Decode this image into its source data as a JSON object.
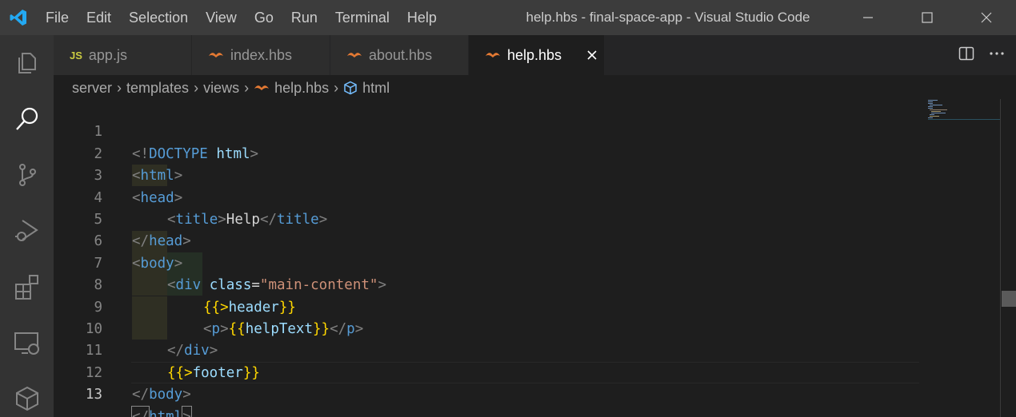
{
  "window": {
    "title": "help.hbs - final-space-app - Visual Studio Code",
    "menu": [
      "File",
      "Edit",
      "Selection",
      "View",
      "Go",
      "Run",
      "Terminal",
      "Help"
    ]
  },
  "activity_bar": [
    "explorer-icon",
    "search-icon",
    "source-control-icon",
    "run-debug-icon",
    "extensions-icon",
    "remote-explorer-icon",
    "docker-icon"
  ],
  "tabs": [
    {
      "label": "app.js",
      "icon": "JS",
      "active": false
    },
    {
      "label": "index.hbs",
      "icon": "handlebars-icon",
      "active": false
    },
    {
      "label": "about.hbs",
      "icon": "handlebars-icon",
      "active": false
    },
    {
      "label": "help.hbs",
      "icon": "handlebars-icon",
      "active": true
    }
  ],
  "breadcrumb": [
    "server",
    "templates",
    "views",
    "help.hbs",
    "html"
  ],
  "editor": {
    "line_numbers": [
      "1",
      "2",
      "3",
      "4",
      "5",
      "6",
      "7",
      "8",
      "9",
      "10",
      "11",
      "12",
      "13"
    ],
    "current_line": 13,
    "lines": {
      "l1": {
        "open": "<!",
        "tag": "DOCTYPE",
        "text": " html",
        "close": ">"
      },
      "l2": {
        "open": "<",
        "tag": "html",
        "close": ">"
      },
      "l3": {
        "open": "<",
        "tag": "head",
        "close": ">"
      },
      "l4": {
        "open": "<",
        "tag": "title",
        "mid": ">",
        "text": "Help",
        "open2": "</",
        "tag2": "title",
        "close": ">"
      },
      "l5": {
        "open": "</",
        "tag": "head",
        "close": ">"
      },
      "l6": {
        "open": "<",
        "tag": "body",
        "close": ">"
      },
      "l7": {
        "open": "<",
        "tag": "div",
        "attr": " class",
        "eq": "=",
        "str": "\"main-content\"",
        "close": ">"
      },
      "l8": {
        "mus_open": "{{>",
        "name": "header",
        "mus_close": "}}"
      },
      "l9": {
        "open": "<",
        "tag": "p",
        "mid": ">",
        "mus_open": "{{",
        "name": "helpText",
        "mus_close": "}}",
        "open2": "</",
        "tag2": "p",
        "close": ">"
      },
      "l10": {
        "open": "</",
        "tag": "div",
        "close": ">"
      },
      "l11": {
        "mus_open": "{{>",
        "name": "footer",
        "mus_close": "}}"
      },
      "l12": {
        "open": "</",
        "tag": "body",
        "close": ">"
      },
      "l13": {
        "open": "</",
        "tag": "html",
        "close": ">"
      }
    }
  },
  "colors": {
    "titlebar": "#3c3c3c",
    "activitybar": "#333333",
    "editor_bg": "#1e1e1e",
    "tag": "#569cd6",
    "attribute": "#9cdcfe",
    "string": "#ce9178",
    "mustache": "#ffd700",
    "handlebars_icon": "#e37933",
    "js_icon": "#cbcb41"
  }
}
